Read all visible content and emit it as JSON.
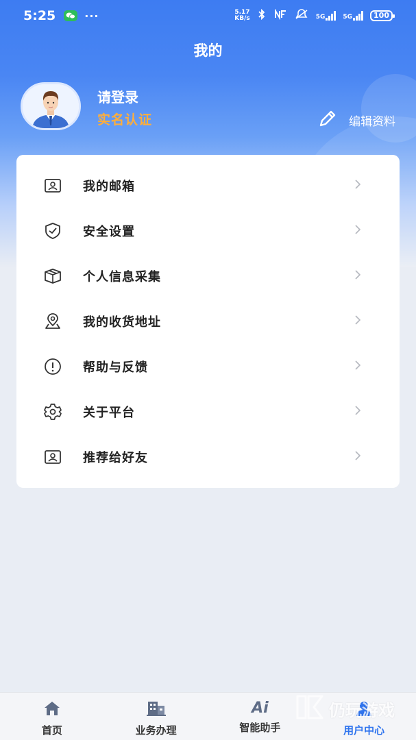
{
  "status_bar": {
    "time": "5:25",
    "net_speed_value": "5.17",
    "net_speed_unit": "KB/s",
    "network_1": "5G",
    "network_2": "5G",
    "battery": "100"
  },
  "header": {
    "title": "我的"
  },
  "profile": {
    "login_prompt": "请登录",
    "verify_label": "实名认证",
    "edit_label": "编辑资料"
  },
  "menu": {
    "items": [
      {
        "label": "我的邮箱",
        "icon": "mailbox-icon"
      },
      {
        "label": "安全设置",
        "icon": "shield-check-icon"
      },
      {
        "label": "个人信息采集",
        "icon": "package-box-icon"
      },
      {
        "label": "我的收货地址",
        "icon": "location-pin-icon"
      },
      {
        "label": "帮助与反馈",
        "icon": "alert-circle-icon"
      },
      {
        "label": "关于平台",
        "icon": "gear-icon"
      },
      {
        "label": "推荐给好友",
        "icon": "recommend-icon"
      }
    ]
  },
  "tabbar": {
    "tabs": [
      {
        "label": "首页",
        "icon": "home-icon"
      },
      {
        "label": "业务办理",
        "icon": "building-icon"
      },
      {
        "label": "智能助手",
        "icon": "ai-icon",
        "icon_text": "Ai"
      },
      {
        "label": "用户中心",
        "icon": "user-center-icon"
      }
    ],
    "active_index": 3
  },
  "watermark": {
    "text": "仍玩游戏"
  },
  "colors": {
    "brand_blue": "#3d7cf2",
    "accent_orange": "#ffae3c",
    "active_tab": "#2f74ee"
  }
}
